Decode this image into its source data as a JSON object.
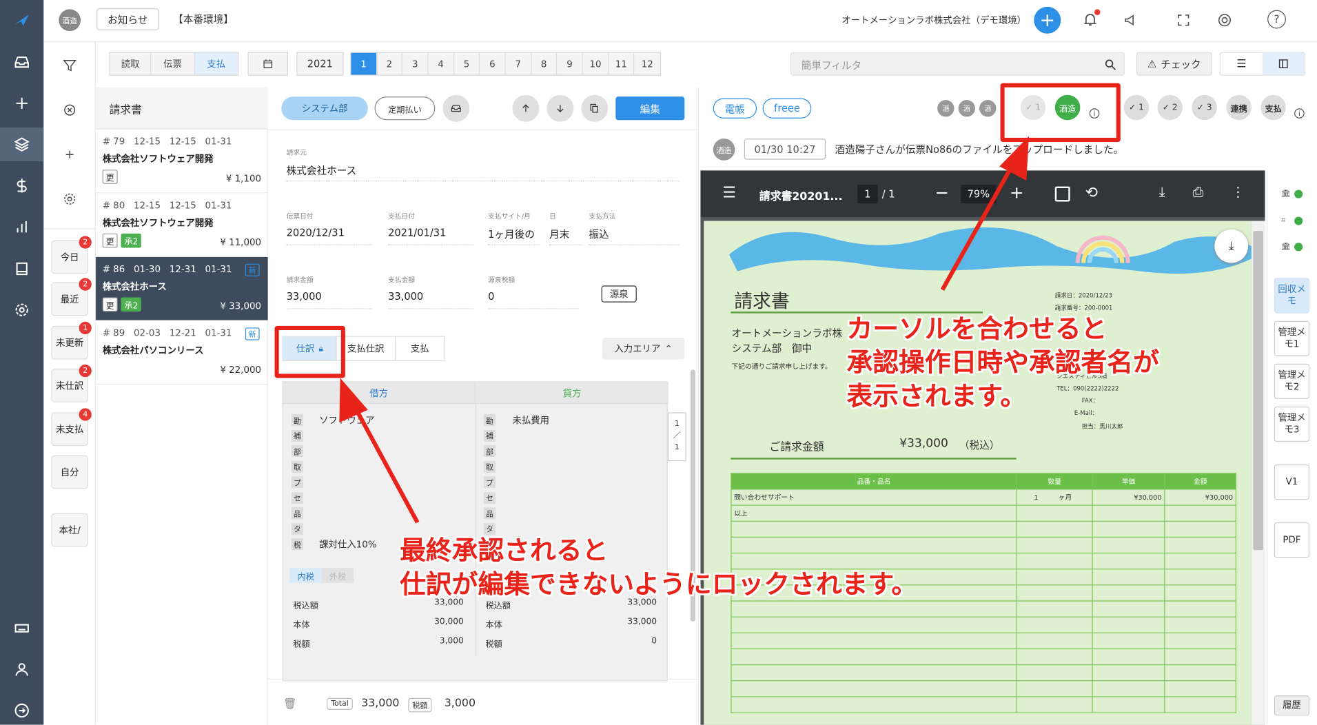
{
  "topbar": {
    "avatar": "酒造",
    "notice": "お知らせ",
    "env": "【本番環境】",
    "company": "オートメーションラボ株式会社（デモ環境）"
  },
  "rail": {
    "icons": [
      "logo-icon",
      "inbox-icon",
      "plus-icon",
      "layers-icon",
      "dollar-icon",
      "chart-icon",
      "book-icon",
      "settings-icon",
      "keyboard-icon",
      "user-icon",
      "logout-icon"
    ]
  },
  "col2": {
    "buttons": [
      {
        "label": "今日",
        "badge": "2"
      },
      {
        "label": "最近",
        "badge": "2"
      },
      {
        "label": "未更新",
        "badge": "1"
      },
      {
        "label": "未仕訳",
        "badge": "2"
      },
      {
        "label": "未支払",
        "badge": "4"
      },
      {
        "label": "自分",
        "badge": ""
      },
      {
        "label": "本社/",
        "badge": ""
      }
    ]
  },
  "filter": {
    "tabs": [
      "読取",
      "伝票",
      "支払"
    ],
    "year": "2021",
    "months": [
      "1",
      "2",
      "3",
      "4",
      "5",
      "6",
      "7",
      "8",
      "9",
      "10",
      "11",
      "12"
    ],
    "search_placeholder": "簡単フィルタ",
    "check": "チェック"
  },
  "list": {
    "title": "請求書",
    "items": [
      {
        "meta": "# 79   12-15   12-15   01-31",
        "name": "株式会社ソフトウェア開発",
        "tags": [
          "更"
        ],
        "green": "",
        "amount": "¥ 1,100",
        "new": ""
      },
      {
        "meta": "# 80   12-15   12-15   01-31",
        "name": "株式会社ソフトウェア開発",
        "tags": [
          "更"
        ],
        "green": "承2",
        "amount": "¥ 11,000",
        "new": ""
      },
      {
        "meta": "# 86   01-30   12-31   01-31",
        "name": "株式会社ホース",
        "tags": [
          "更"
        ],
        "green": "承2",
        "amount": "¥ 33,000",
        "new": "新"
      },
      {
        "meta": "# 89   02-03   12-21   01-31",
        "name": "株式会社パソコンリース",
        "tags": [],
        "green": "",
        "amount": "¥ 22,000",
        "new": "新"
      }
    ]
  },
  "detail": {
    "dept": "システム部",
    "regular": "定期払い",
    "edit": "編集",
    "seller_label": "請求元",
    "seller": "株式会社ホース",
    "fields1": [
      {
        "l": "伝票日付",
        "v": "2020/12/31"
      },
      {
        "l": "支払日付",
        "v": "2021/01/31"
      },
      {
        "l": "支払サイト/月",
        "v": "1ヶ月後の"
      },
      {
        "l": "日",
        "v": "月末"
      },
      {
        "l": "支払方法",
        "v": "振込"
      }
    ],
    "fields2": [
      {
        "l": "請求金額",
        "v": "33,000"
      },
      {
        "l": "支払金額",
        "v": "33,000"
      },
      {
        "l": "源泉税額",
        "v": "0"
      }
    ],
    "gensen": "源泉",
    "tabs": [
      "仕訳",
      "支払仕訳",
      "支払"
    ],
    "input_area": "入力エリア",
    "debit": "借方",
    "credit": "貸方",
    "debit_chars": [
      "勘",
      "補",
      "部",
      "取",
      "プ",
      "セ",
      "品",
      "タ",
      "税"
    ],
    "debit_acct": "ソフトウェア",
    "credit_acct": "未払費用",
    "tax_class": "課対仕入10%",
    "page_ind": [
      "1",
      "／",
      "1"
    ],
    "tax_toggle": [
      "内税",
      "外税"
    ],
    "sums": [
      {
        "l": "税込額",
        "d": "33,000",
        "c": "33,000"
      },
      {
        "l": "本体",
        "d": "30,000",
        "c": "33,000"
      },
      {
        "l": "税額",
        "d": "3,000",
        "c": "0"
      }
    ],
    "total_label": "Total",
    "total": "33,000",
    "tax_label": "税額",
    "tax": "3,000"
  },
  "right": {
    "chips": [
      "電帳",
      "freee"
    ],
    "approvers": [
      "酒",
      "酒",
      "酒"
    ],
    "approved_by": "酒造",
    "steps": [
      "✓ 1",
      "✓ 1",
      "✓ 2",
      "✓ 3"
    ],
    "link": "連携",
    "pay": "支払",
    "log_avatar": "酒造",
    "log_time": "01/30 10:27",
    "log_text": "酒造陽子さんが伝票No86のファイルをアップロードしました。",
    "side_buttons": [
      "回収メモ",
      "管理メモ1",
      "管理メモ2",
      "管理メモ3",
      "V1",
      "PDF",
      "履歴"
    ]
  },
  "pdf": {
    "filename": "請求書20201...",
    "page": "1",
    "pages": "/ 1",
    "zoom": "79%",
    "doc_title": "請求書",
    "to_company": "オートメーションラボ株",
    "to_dept": "システム部　御中",
    "note": "下記の通りご請求申し上げます。",
    "issue_date": "請求日：2020/12/23",
    "issue_no": "請求番号：200-0001",
    "sender_frag": "シエスティヒル5階",
    "tel": "TEL：090(2222)2222",
    "fax": "FAX：",
    "email": "E-Mail：",
    "person": "担当：馬川太郎",
    "total_label": "ご請求金額",
    "total": "¥33,000",
    "total_note": "（税込）",
    "cols": [
      "品番・品名",
      "数量",
      "単価",
      "金額"
    ],
    "row1": [
      "問い合わせサポート",
      "1　　　ヶ月",
      "¥30,000",
      "¥30,000"
    ],
    "row2": "以上"
  },
  "annotations": {
    "a1": [
      "カーソルを合わせると",
      "承認操作日時や承認者名が",
      "表示されます。"
    ],
    "a2": [
      "最終承認されると",
      "仕訳が編集できないようにロックされます。"
    ]
  },
  "colors": {
    "accent": "#2d8fe6",
    "green": "#4caf50",
    "red": "#e8231a",
    "rail": "#3d4b5c"
  }
}
